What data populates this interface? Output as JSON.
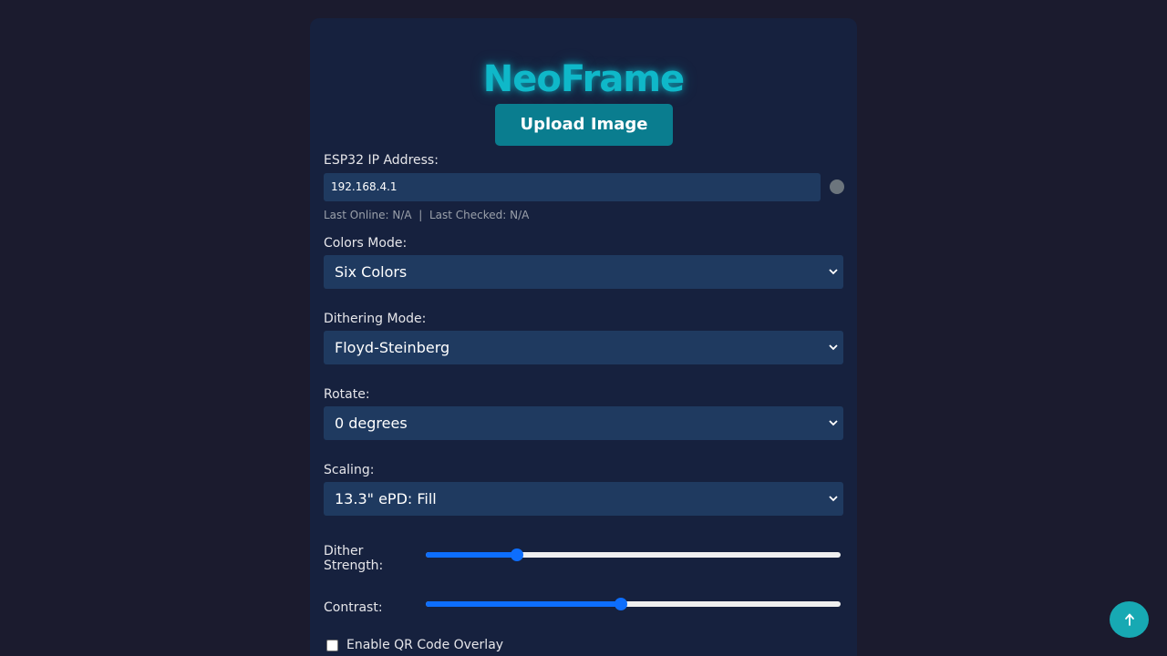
{
  "app": {
    "title": "NeoFrame",
    "upload_label": "Upload Image"
  },
  "ip": {
    "label": "ESP32 IP Address:",
    "value": "192.168.4.1",
    "status_color": "#6c757d",
    "last_online": "Last Online: N/A",
    "separator": "|",
    "last_checked": "Last Checked: N/A"
  },
  "colors_mode": {
    "label": "Colors Mode:",
    "selected": "Six Colors"
  },
  "dithering_mode": {
    "label": "Dithering Mode:",
    "selected": "Floyd-Steinberg"
  },
  "rotate": {
    "label": "Rotate:",
    "selected": "0 degrees"
  },
  "scaling": {
    "label": "Scaling:",
    "selected": "13.3\" ePD: Fill"
  },
  "dither_strength": {
    "label": "Dither Strength:",
    "level_fraction": 0.22
  },
  "contrast": {
    "label": "Contrast:",
    "level_fraction": 0.47
  },
  "qr": {
    "label": "Enable QR Code Overlay",
    "checked": false
  },
  "icons": {
    "dropdown": "chevron-down-icon",
    "scroll_top": "arrow-up-icon"
  },
  "colors": {
    "accent": "#0fb8c9",
    "button": "#0a7d8f",
    "slider": "#0d6efd",
    "panel": "#16213e",
    "background": "#1b1b2e"
  }
}
